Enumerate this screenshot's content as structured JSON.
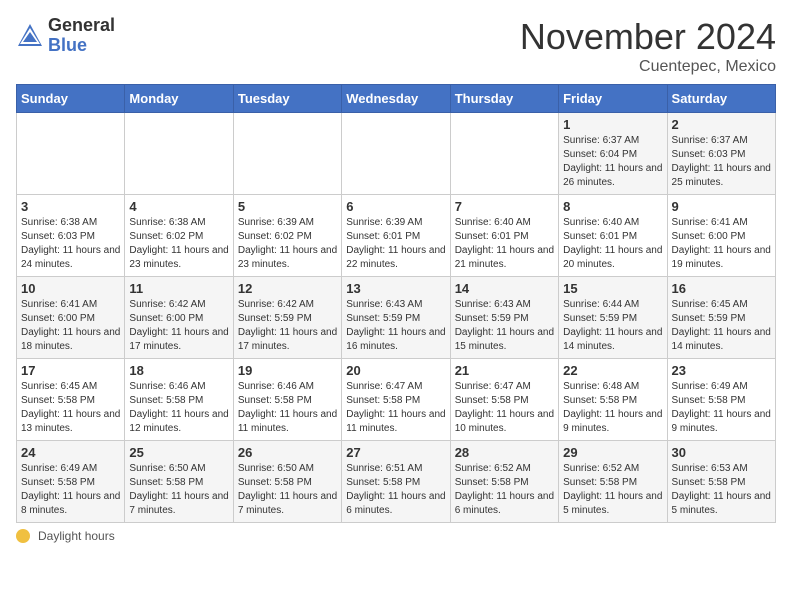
{
  "logo": {
    "general": "General",
    "blue": "Blue"
  },
  "title": "November 2024",
  "subtitle": "Cuentepec, Mexico",
  "days_of_week": [
    "Sunday",
    "Monday",
    "Tuesday",
    "Wednesday",
    "Thursday",
    "Friday",
    "Saturday"
  ],
  "legend_label": "Daylight hours",
  "weeks": [
    [
      {
        "day": "",
        "sunrise": "",
        "sunset": "",
        "daylight": ""
      },
      {
        "day": "",
        "sunrise": "",
        "sunset": "",
        "daylight": ""
      },
      {
        "day": "",
        "sunrise": "",
        "sunset": "",
        "daylight": ""
      },
      {
        "day": "",
        "sunrise": "",
        "sunset": "",
        "daylight": ""
      },
      {
        "day": "",
        "sunrise": "",
        "sunset": "",
        "daylight": ""
      },
      {
        "day": "1",
        "sunrise": "Sunrise: 6:37 AM",
        "sunset": "Sunset: 6:04 PM",
        "daylight": "Daylight: 11 hours and 26 minutes."
      },
      {
        "day": "2",
        "sunrise": "Sunrise: 6:37 AM",
        "sunset": "Sunset: 6:03 PM",
        "daylight": "Daylight: 11 hours and 25 minutes."
      }
    ],
    [
      {
        "day": "3",
        "sunrise": "Sunrise: 6:38 AM",
        "sunset": "Sunset: 6:03 PM",
        "daylight": "Daylight: 11 hours and 24 minutes."
      },
      {
        "day": "4",
        "sunrise": "Sunrise: 6:38 AM",
        "sunset": "Sunset: 6:02 PM",
        "daylight": "Daylight: 11 hours and 23 minutes."
      },
      {
        "day": "5",
        "sunrise": "Sunrise: 6:39 AM",
        "sunset": "Sunset: 6:02 PM",
        "daylight": "Daylight: 11 hours and 23 minutes."
      },
      {
        "day": "6",
        "sunrise": "Sunrise: 6:39 AM",
        "sunset": "Sunset: 6:01 PM",
        "daylight": "Daylight: 11 hours and 22 minutes."
      },
      {
        "day": "7",
        "sunrise": "Sunrise: 6:40 AM",
        "sunset": "Sunset: 6:01 PM",
        "daylight": "Daylight: 11 hours and 21 minutes."
      },
      {
        "day": "8",
        "sunrise": "Sunrise: 6:40 AM",
        "sunset": "Sunset: 6:01 PM",
        "daylight": "Daylight: 11 hours and 20 minutes."
      },
      {
        "day": "9",
        "sunrise": "Sunrise: 6:41 AM",
        "sunset": "Sunset: 6:00 PM",
        "daylight": "Daylight: 11 hours and 19 minutes."
      }
    ],
    [
      {
        "day": "10",
        "sunrise": "Sunrise: 6:41 AM",
        "sunset": "Sunset: 6:00 PM",
        "daylight": "Daylight: 11 hours and 18 minutes."
      },
      {
        "day": "11",
        "sunrise": "Sunrise: 6:42 AM",
        "sunset": "Sunset: 6:00 PM",
        "daylight": "Daylight: 11 hours and 17 minutes."
      },
      {
        "day": "12",
        "sunrise": "Sunrise: 6:42 AM",
        "sunset": "Sunset: 5:59 PM",
        "daylight": "Daylight: 11 hours and 17 minutes."
      },
      {
        "day": "13",
        "sunrise": "Sunrise: 6:43 AM",
        "sunset": "Sunset: 5:59 PM",
        "daylight": "Daylight: 11 hours and 16 minutes."
      },
      {
        "day": "14",
        "sunrise": "Sunrise: 6:43 AM",
        "sunset": "Sunset: 5:59 PM",
        "daylight": "Daylight: 11 hours and 15 minutes."
      },
      {
        "day": "15",
        "sunrise": "Sunrise: 6:44 AM",
        "sunset": "Sunset: 5:59 PM",
        "daylight": "Daylight: 11 hours and 14 minutes."
      },
      {
        "day": "16",
        "sunrise": "Sunrise: 6:45 AM",
        "sunset": "Sunset: 5:59 PM",
        "daylight": "Daylight: 11 hours and 14 minutes."
      }
    ],
    [
      {
        "day": "17",
        "sunrise": "Sunrise: 6:45 AM",
        "sunset": "Sunset: 5:58 PM",
        "daylight": "Daylight: 11 hours and 13 minutes."
      },
      {
        "day": "18",
        "sunrise": "Sunrise: 6:46 AM",
        "sunset": "Sunset: 5:58 PM",
        "daylight": "Daylight: 11 hours and 12 minutes."
      },
      {
        "day": "19",
        "sunrise": "Sunrise: 6:46 AM",
        "sunset": "Sunset: 5:58 PM",
        "daylight": "Daylight: 11 hours and 11 minutes."
      },
      {
        "day": "20",
        "sunrise": "Sunrise: 6:47 AM",
        "sunset": "Sunset: 5:58 PM",
        "daylight": "Daylight: 11 hours and 11 minutes."
      },
      {
        "day": "21",
        "sunrise": "Sunrise: 6:47 AM",
        "sunset": "Sunset: 5:58 PM",
        "daylight": "Daylight: 11 hours and 10 minutes."
      },
      {
        "day": "22",
        "sunrise": "Sunrise: 6:48 AM",
        "sunset": "Sunset: 5:58 PM",
        "daylight": "Daylight: 11 hours and 9 minutes."
      },
      {
        "day": "23",
        "sunrise": "Sunrise: 6:49 AM",
        "sunset": "Sunset: 5:58 PM",
        "daylight": "Daylight: 11 hours and 9 minutes."
      }
    ],
    [
      {
        "day": "24",
        "sunrise": "Sunrise: 6:49 AM",
        "sunset": "Sunset: 5:58 PM",
        "daylight": "Daylight: 11 hours and 8 minutes."
      },
      {
        "day": "25",
        "sunrise": "Sunrise: 6:50 AM",
        "sunset": "Sunset: 5:58 PM",
        "daylight": "Daylight: 11 hours and 7 minutes."
      },
      {
        "day": "26",
        "sunrise": "Sunrise: 6:50 AM",
        "sunset": "Sunset: 5:58 PM",
        "daylight": "Daylight: 11 hours and 7 minutes."
      },
      {
        "day": "27",
        "sunrise": "Sunrise: 6:51 AM",
        "sunset": "Sunset: 5:58 PM",
        "daylight": "Daylight: 11 hours and 6 minutes."
      },
      {
        "day": "28",
        "sunrise": "Sunrise: 6:52 AM",
        "sunset": "Sunset: 5:58 PM",
        "daylight": "Daylight: 11 hours and 6 minutes."
      },
      {
        "day": "29",
        "sunrise": "Sunrise: 6:52 AM",
        "sunset": "Sunset: 5:58 PM",
        "daylight": "Daylight: 11 hours and 5 minutes."
      },
      {
        "day": "30",
        "sunrise": "Sunrise: 6:53 AM",
        "sunset": "Sunset: 5:58 PM",
        "daylight": "Daylight: 11 hours and 5 minutes."
      }
    ]
  ]
}
